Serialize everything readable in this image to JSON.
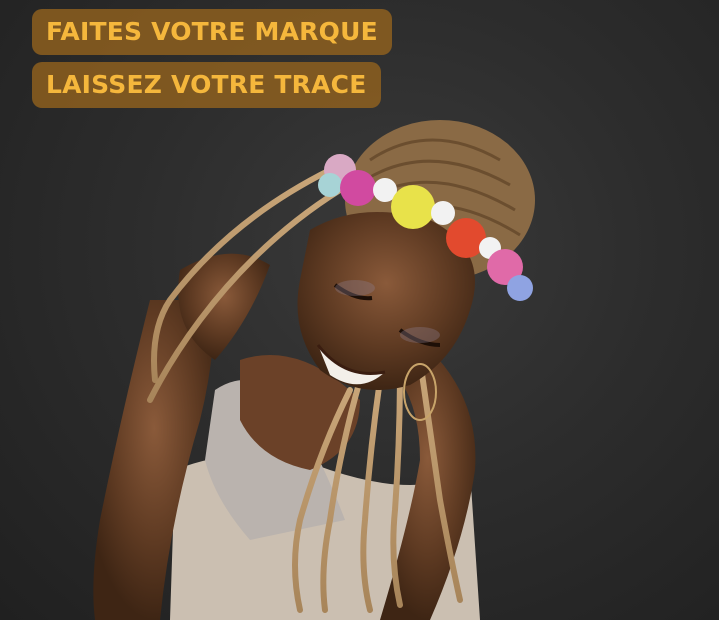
{
  "overlay": {
    "line1": "FAITES VOTRE MARQUE",
    "line2": "LAISSEZ VOTRE TRACE"
  },
  "colors": {
    "background": "#2d2d2d",
    "banner_bg": "#96641e",
    "banner_text": "#f5b73c"
  }
}
